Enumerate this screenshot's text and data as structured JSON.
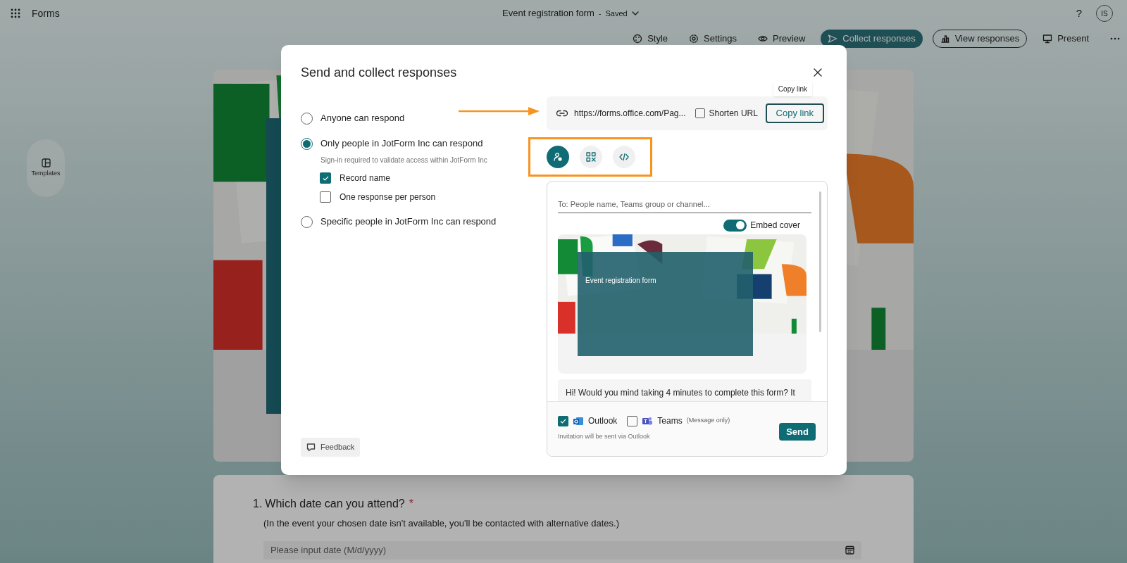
{
  "app": {
    "name": "Forms"
  },
  "header": {
    "title": "Event registration form",
    "separator": "-",
    "status": "Saved",
    "help": "?",
    "avatar": "IS"
  },
  "toolbar": [
    {
      "label": "Style",
      "kind": "plain"
    },
    {
      "label": "Settings",
      "kind": "plain"
    },
    {
      "label": "Preview",
      "kind": "plain"
    },
    {
      "label": "Collect responses",
      "kind": "primary"
    },
    {
      "label": "View responses",
      "kind": "outline"
    },
    {
      "label": "Present",
      "kind": "plain"
    }
  ],
  "sidebar": {
    "templates": "Templates"
  },
  "dialog": {
    "title": "Send and collect responses",
    "options": [
      {
        "label": "Anyone can respond",
        "selected": false
      },
      {
        "label": "Only people in JotForm Inc can respond",
        "selected": true,
        "note": "Sign-in required to validate access within JotForm Inc",
        "settings": [
          {
            "label": "Record name",
            "checked": true
          },
          {
            "label": "One response per person",
            "checked": false
          }
        ]
      },
      {
        "label": "Specific people in JotForm Inc can respond",
        "selected": false
      }
    ],
    "link": {
      "url": "https://forms.office.com/Pag...",
      "shorten": {
        "label": "Shorten URL",
        "checked": false
      },
      "button": "Copy link",
      "tooltip": "Copy link"
    },
    "share_tabs": [
      {
        "kind": "invite",
        "selected": true
      },
      {
        "kind": "qr",
        "selected": false
      },
      {
        "kind": "embed",
        "selected": false
      }
    ],
    "invite": {
      "placeholder": "To: People name, Teams group or channel...",
      "embed_cover": {
        "label": "Embed cover",
        "on": true
      },
      "preview_title": "Event registration form",
      "message": "Hi! Would you mind taking 4 minutes to complete this form? It",
      "channels": [
        {
          "kind": "outlook",
          "label": "Outlook",
          "checked": true
        },
        {
          "kind": "teams",
          "label": "Teams",
          "note": "(Message only)",
          "checked": false
        }
      ],
      "hint": "Invitation will be sent via Outlook",
      "send": "Send"
    },
    "feedback": "Feedback"
  },
  "question": {
    "number": "1.",
    "text": "Which date can you attend?",
    "required_mark": "*",
    "description": "(In the event your chosen date isn't available, you'll be contacted with alternative dates.)",
    "placeholder": "Please input date (M/d/yyyy)"
  }
}
